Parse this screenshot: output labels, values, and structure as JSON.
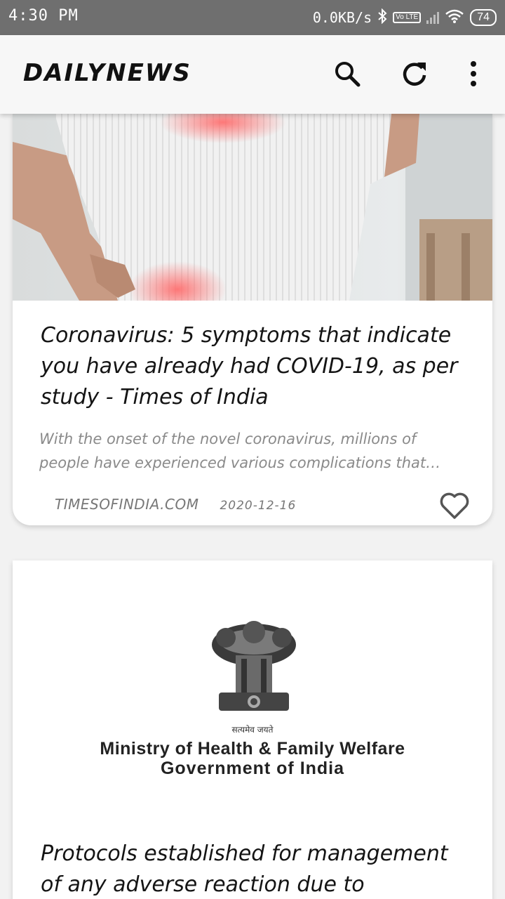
{
  "status_bar": {
    "time": "4:30 PM",
    "network_speed": "0.0KB/s",
    "volte_label": "Vo LTE",
    "battery_level": "74",
    "icons": [
      "bluetooth-icon",
      "signal-icon",
      "wifi-icon",
      "battery-icon"
    ]
  },
  "app_bar": {
    "title": "DAILYNEWS",
    "actions": [
      "search-icon",
      "refresh-icon",
      "more-vert-icon"
    ]
  },
  "articles": [
    {
      "title": "Coronavirus: 5 symptoms that indicate you have already had COVID-19, as per study - Times of India",
      "description": "With the onset of the novel coronavirus, millions of people have experienced various complications that…",
      "source": "TIMESOFINDIA.COM",
      "date": "2020-12-16",
      "favorite_icon": "heart-outline-icon"
    },
    {
      "image_caption_line1": "Ministry of Health & Family Welfare",
      "image_caption_line2": "Government of India",
      "image_motto": "सत्यमेव जयते",
      "title": "Protocols established for management of any adverse reaction due to coronavirus"
    }
  ],
  "colors": {
    "status_bar_bg": "#6f6f6f",
    "app_bar_bg": "#f7f7f7",
    "page_bg": "#f2f2f2",
    "card_bg": "#ffffff",
    "headline_text": "#141414",
    "meta_text": "#777777"
  }
}
